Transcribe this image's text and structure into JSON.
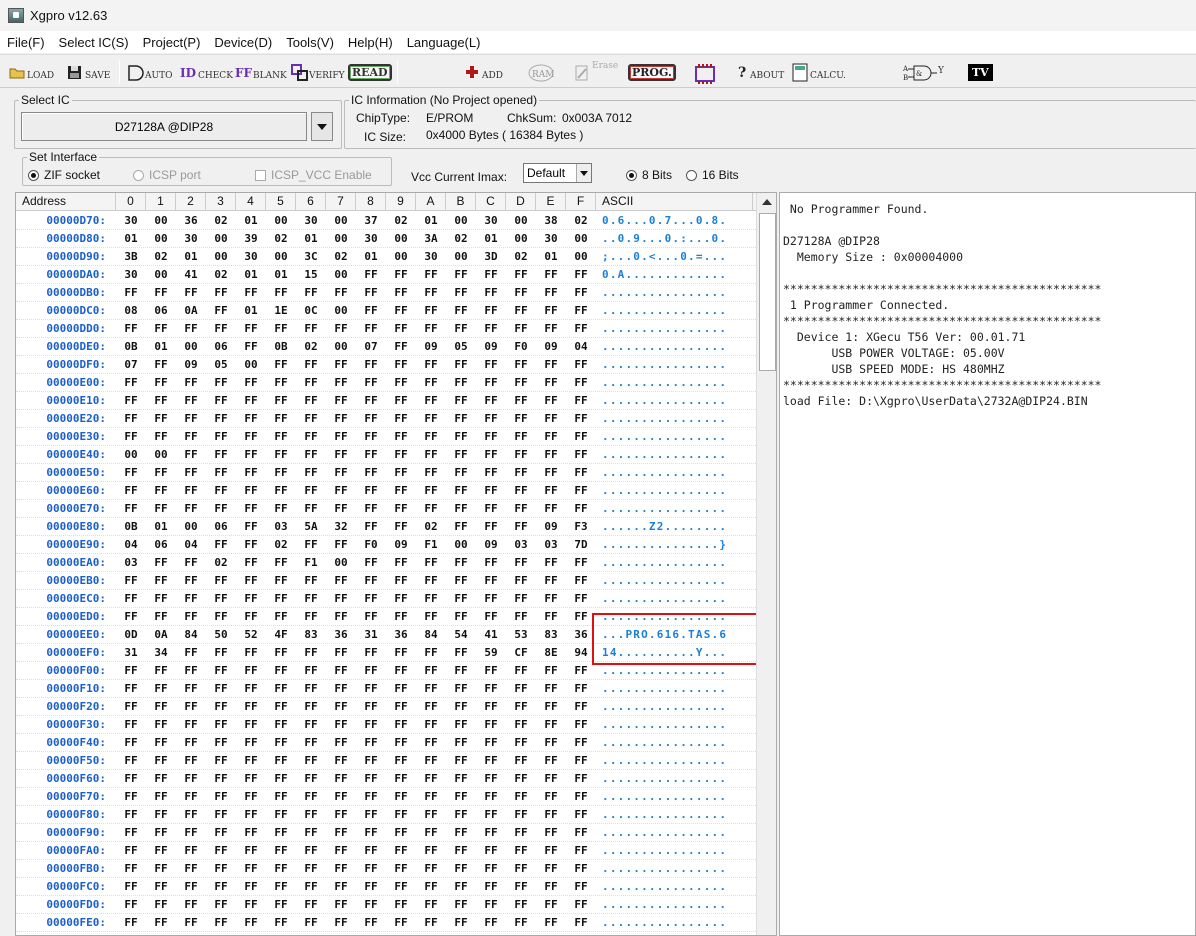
{
  "window": {
    "title": "Xgpro v12.63"
  },
  "menu": [
    "File(F)",
    "Select IC(S)",
    "Project(P)",
    "Device(D)",
    "Tools(V)",
    "Help(H)",
    "Language(L)"
  ],
  "toolbar": {
    "load": "LOAD",
    "save": "SAVE",
    "auto": "AUTO",
    "check": "CHECK",
    "blank": "BLANK",
    "verify": "VERIFY",
    "read": "READ",
    "add": "ADD",
    "ram": "RAM",
    "erase": "Erase",
    "prog": "PROG.",
    "about": "ABOUT",
    "calcu": "CALCU.",
    "logic_y": "Y",
    "tv": "TV"
  },
  "select_ic": {
    "legend": "Select IC",
    "value": "D27128A @DIP28"
  },
  "ic_info": {
    "legend": "IC Information (No Project opened)",
    "chiptype_label": "ChipType:",
    "chiptype": "E/PROM",
    "chksum_label": "ChkSum:",
    "chksum": "0x003A 7012",
    "icsize_label": "IC Size:",
    "icsize": "0x4000 Bytes ( 16384 Bytes )"
  },
  "interface": {
    "legend": "Set Interface",
    "zif": "ZIF socket",
    "icsp": "ICSP port",
    "icsp_vcc": "ICSP_VCC Enable"
  },
  "vcc": {
    "label": "Vcc Current Imax:",
    "value": "Default"
  },
  "bits": {
    "opt8": "8 Bits",
    "opt16": "16 Bits",
    "selected": "8 Bits"
  },
  "hex": {
    "headers": [
      "Address",
      "0",
      "1",
      "2",
      "3",
      "4",
      "5",
      "6",
      "7",
      "8",
      "9",
      "A",
      "B",
      "C",
      "D",
      "E",
      "F",
      "ASCII"
    ],
    "rows": [
      {
        "addr": "00000D70:",
        "bytes": [
          "30",
          "00",
          "36",
          "02",
          "01",
          "00",
          "30",
          "00",
          "37",
          "02",
          "01",
          "00",
          "30",
          "00",
          "38",
          "02"
        ],
        "ascii": "0.6...0.7...0.8."
      },
      {
        "addr": "00000D80:",
        "bytes": [
          "01",
          "00",
          "30",
          "00",
          "39",
          "02",
          "01",
          "00",
          "30",
          "00",
          "3A",
          "02",
          "01",
          "00",
          "30",
          "00"
        ],
        "ascii": "..0.9...0.:...0."
      },
      {
        "addr": "00000D90:",
        "bytes": [
          "3B",
          "02",
          "01",
          "00",
          "30",
          "00",
          "3C",
          "02",
          "01",
          "00",
          "30",
          "00",
          "3D",
          "02",
          "01",
          "00"
        ],
        "ascii": ";...0.<...0.=..."
      },
      {
        "addr": "00000DA0:",
        "bytes": [
          "30",
          "00",
          "41",
          "02",
          "01",
          "01",
          "15",
          "00",
          "FF",
          "FF",
          "FF",
          "FF",
          "FF",
          "FF",
          "FF",
          "FF"
        ],
        "ascii": "0.A............."
      },
      {
        "addr": "00000DB0:",
        "bytes": [
          "FF",
          "FF",
          "FF",
          "FF",
          "FF",
          "FF",
          "FF",
          "FF",
          "FF",
          "FF",
          "FF",
          "FF",
          "FF",
          "FF",
          "FF",
          "FF"
        ],
        "ascii": "................"
      },
      {
        "addr": "00000DC0:",
        "bytes": [
          "08",
          "06",
          "0A",
          "FF",
          "01",
          "1E",
          "0C",
          "00",
          "FF",
          "FF",
          "FF",
          "FF",
          "FF",
          "FF",
          "FF",
          "FF"
        ],
        "ascii": "................"
      },
      {
        "addr": "00000DD0:",
        "bytes": [
          "FF",
          "FF",
          "FF",
          "FF",
          "FF",
          "FF",
          "FF",
          "FF",
          "FF",
          "FF",
          "FF",
          "FF",
          "FF",
          "FF",
          "FF",
          "FF"
        ],
        "ascii": "................"
      },
      {
        "addr": "00000DE0:",
        "bytes": [
          "0B",
          "01",
          "00",
          "06",
          "FF",
          "0B",
          "02",
          "00",
          "07",
          "FF",
          "09",
          "05",
          "09",
          "F0",
          "09",
          "04"
        ],
        "ascii": "................"
      },
      {
        "addr": "00000DF0:",
        "bytes": [
          "07",
          "FF",
          "09",
          "05",
          "00",
          "FF",
          "FF",
          "FF",
          "FF",
          "FF",
          "FF",
          "FF",
          "FF",
          "FF",
          "FF",
          "FF"
        ],
        "ascii": "................"
      },
      {
        "addr": "00000E00:",
        "bytes": [
          "FF",
          "FF",
          "FF",
          "FF",
          "FF",
          "FF",
          "FF",
          "FF",
          "FF",
          "FF",
          "FF",
          "FF",
          "FF",
          "FF",
          "FF",
          "FF"
        ],
        "ascii": "................"
      },
      {
        "addr": "00000E10:",
        "bytes": [
          "FF",
          "FF",
          "FF",
          "FF",
          "FF",
          "FF",
          "FF",
          "FF",
          "FF",
          "FF",
          "FF",
          "FF",
          "FF",
          "FF",
          "FF",
          "FF"
        ],
        "ascii": "................"
      },
      {
        "addr": "00000E20:",
        "bytes": [
          "FF",
          "FF",
          "FF",
          "FF",
          "FF",
          "FF",
          "FF",
          "FF",
          "FF",
          "FF",
          "FF",
          "FF",
          "FF",
          "FF",
          "FF",
          "FF"
        ],
        "ascii": "................"
      },
      {
        "addr": "00000E30:",
        "bytes": [
          "FF",
          "FF",
          "FF",
          "FF",
          "FF",
          "FF",
          "FF",
          "FF",
          "FF",
          "FF",
          "FF",
          "FF",
          "FF",
          "FF",
          "FF",
          "FF"
        ],
        "ascii": "................"
      },
      {
        "addr": "00000E40:",
        "bytes": [
          "00",
          "00",
          "FF",
          "FF",
          "FF",
          "FF",
          "FF",
          "FF",
          "FF",
          "FF",
          "FF",
          "FF",
          "FF",
          "FF",
          "FF",
          "FF"
        ],
        "ascii": "................"
      },
      {
        "addr": "00000E50:",
        "bytes": [
          "FF",
          "FF",
          "FF",
          "FF",
          "FF",
          "FF",
          "FF",
          "FF",
          "FF",
          "FF",
          "FF",
          "FF",
          "FF",
          "FF",
          "FF",
          "FF"
        ],
        "ascii": "................"
      },
      {
        "addr": "00000E60:",
        "bytes": [
          "FF",
          "FF",
          "FF",
          "FF",
          "FF",
          "FF",
          "FF",
          "FF",
          "FF",
          "FF",
          "FF",
          "FF",
          "FF",
          "FF",
          "FF",
          "FF"
        ],
        "ascii": "................"
      },
      {
        "addr": "00000E70:",
        "bytes": [
          "FF",
          "FF",
          "FF",
          "FF",
          "FF",
          "FF",
          "FF",
          "FF",
          "FF",
          "FF",
          "FF",
          "FF",
          "FF",
          "FF",
          "FF",
          "FF"
        ],
        "ascii": "................"
      },
      {
        "addr": "00000E80:",
        "bytes": [
          "0B",
          "01",
          "00",
          "06",
          "FF",
          "03",
          "5A",
          "32",
          "FF",
          "FF",
          "02",
          "FF",
          "FF",
          "FF",
          "09",
          "F3"
        ],
        "ascii": "......Z2........"
      },
      {
        "addr": "00000E90:",
        "bytes": [
          "04",
          "06",
          "04",
          "FF",
          "FF",
          "02",
          "FF",
          "FF",
          "F0",
          "09",
          "F1",
          "00",
          "09",
          "03",
          "03",
          "7D"
        ],
        "ascii": "...............}"
      },
      {
        "addr": "00000EA0:",
        "bytes": [
          "03",
          "FF",
          "FF",
          "02",
          "FF",
          "FF",
          "F1",
          "00",
          "FF",
          "FF",
          "FF",
          "FF",
          "FF",
          "FF",
          "FF",
          "FF"
        ],
        "ascii": "................"
      },
      {
        "addr": "00000EB0:",
        "bytes": [
          "FF",
          "FF",
          "FF",
          "FF",
          "FF",
          "FF",
          "FF",
          "FF",
          "FF",
          "FF",
          "FF",
          "FF",
          "FF",
          "FF",
          "FF",
          "FF"
        ],
        "ascii": "................"
      },
      {
        "addr": "00000EC0:",
        "bytes": [
          "FF",
          "FF",
          "FF",
          "FF",
          "FF",
          "FF",
          "FF",
          "FF",
          "FF",
          "FF",
          "FF",
          "FF",
          "FF",
          "FF",
          "FF",
          "FF"
        ],
        "ascii": "................"
      },
      {
        "addr": "00000ED0:",
        "bytes": [
          "FF",
          "FF",
          "FF",
          "FF",
          "FF",
          "FF",
          "FF",
          "FF",
          "FF",
          "FF",
          "FF",
          "FF",
          "FF",
          "FF",
          "FF",
          "FF"
        ],
        "ascii": "................"
      },
      {
        "addr": "00000EE0:",
        "bytes": [
          "0D",
          "0A",
          "84",
          "50",
          "52",
          "4F",
          "83",
          "36",
          "31",
          "36",
          "84",
          "54",
          "41",
          "53",
          "83",
          "36"
        ],
        "ascii": "...PRO.616.TAS.6"
      },
      {
        "addr": "00000EF0:",
        "bytes": [
          "31",
          "34",
          "FF",
          "FF",
          "FF",
          "FF",
          "FF",
          "FF",
          "FF",
          "FF",
          "FF",
          "FF",
          "59",
          "CF",
          "8E",
          "94"
        ],
        "ascii": "14..........Y..."
      },
      {
        "addr": "00000F00:",
        "bytes": [
          "FF",
          "FF",
          "FF",
          "FF",
          "FF",
          "FF",
          "FF",
          "FF",
          "FF",
          "FF",
          "FF",
          "FF",
          "FF",
          "FF",
          "FF",
          "FF"
        ],
        "ascii": "................"
      },
      {
        "addr": "00000F10:",
        "bytes": [
          "FF",
          "FF",
          "FF",
          "FF",
          "FF",
          "FF",
          "FF",
          "FF",
          "FF",
          "FF",
          "FF",
          "FF",
          "FF",
          "FF",
          "FF",
          "FF"
        ],
        "ascii": "................"
      },
      {
        "addr": "00000F20:",
        "bytes": [
          "FF",
          "FF",
          "FF",
          "FF",
          "FF",
          "FF",
          "FF",
          "FF",
          "FF",
          "FF",
          "FF",
          "FF",
          "FF",
          "FF",
          "FF",
          "FF"
        ],
        "ascii": "................"
      },
      {
        "addr": "00000F30:",
        "bytes": [
          "FF",
          "FF",
          "FF",
          "FF",
          "FF",
          "FF",
          "FF",
          "FF",
          "FF",
          "FF",
          "FF",
          "FF",
          "FF",
          "FF",
          "FF",
          "FF"
        ],
        "ascii": "................"
      },
      {
        "addr": "00000F40:",
        "bytes": [
          "FF",
          "FF",
          "FF",
          "FF",
          "FF",
          "FF",
          "FF",
          "FF",
          "FF",
          "FF",
          "FF",
          "FF",
          "FF",
          "FF",
          "FF",
          "FF"
        ],
        "ascii": "................"
      },
      {
        "addr": "00000F50:",
        "bytes": [
          "FF",
          "FF",
          "FF",
          "FF",
          "FF",
          "FF",
          "FF",
          "FF",
          "FF",
          "FF",
          "FF",
          "FF",
          "FF",
          "FF",
          "FF",
          "FF"
        ],
        "ascii": "................"
      },
      {
        "addr": "00000F60:",
        "bytes": [
          "FF",
          "FF",
          "FF",
          "FF",
          "FF",
          "FF",
          "FF",
          "FF",
          "FF",
          "FF",
          "FF",
          "FF",
          "FF",
          "FF",
          "FF",
          "FF"
        ],
        "ascii": "................"
      },
      {
        "addr": "00000F70:",
        "bytes": [
          "FF",
          "FF",
          "FF",
          "FF",
          "FF",
          "FF",
          "FF",
          "FF",
          "FF",
          "FF",
          "FF",
          "FF",
          "FF",
          "FF",
          "FF",
          "FF"
        ],
        "ascii": "................"
      },
      {
        "addr": "00000F80:",
        "bytes": [
          "FF",
          "FF",
          "FF",
          "FF",
          "FF",
          "FF",
          "FF",
          "FF",
          "FF",
          "FF",
          "FF",
          "FF",
          "FF",
          "FF",
          "FF",
          "FF"
        ],
        "ascii": "................"
      },
      {
        "addr": "00000F90:",
        "bytes": [
          "FF",
          "FF",
          "FF",
          "FF",
          "FF",
          "FF",
          "FF",
          "FF",
          "FF",
          "FF",
          "FF",
          "FF",
          "FF",
          "FF",
          "FF",
          "FF"
        ],
        "ascii": "................"
      },
      {
        "addr": "00000FA0:",
        "bytes": [
          "FF",
          "FF",
          "FF",
          "FF",
          "FF",
          "FF",
          "FF",
          "FF",
          "FF",
          "FF",
          "FF",
          "FF",
          "FF",
          "FF",
          "FF",
          "FF"
        ],
        "ascii": "................"
      },
      {
        "addr": "00000FB0:",
        "bytes": [
          "FF",
          "FF",
          "FF",
          "FF",
          "FF",
          "FF",
          "FF",
          "FF",
          "FF",
          "FF",
          "FF",
          "FF",
          "FF",
          "FF",
          "FF",
          "FF"
        ],
        "ascii": "................"
      },
      {
        "addr": "00000FC0:",
        "bytes": [
          "FF",
          "FF",
          "FF",
          "FF",
          "FF",
          "FF",
          "FF",
          "FF",
          "FF",
          "FF",
          "FF",
          "FF",
          "FF",
          "FF",
          "FF",
          "FF"
        ],
        "ascii": "................"
      },
      {
        "addr": "00000FD0:",
        "bytes": [
          "FF",
          "FF",
          "FF",
          "FF",
          "FF",
          "FF",
          "FF",
          "FF",
          "FF",
          "FF",
          "FF",
          "FF",
          "FF",
          "FF",
          "FF",
          "FF"
        ],
        "ascii": "................"
      },
      {
        "addr": "00000FE0:",
        "bytes": [
          "FF",
          "FF",
          "FF",
          "FF",
          "FF",
          "FF",
          "FF",
          "FF",
          "FF",
          "FF",
          "FF",
          "FF",
          "FF",
          "FF",
          "FF",
          "FF"
        ],
        "ascii": "................"
      }
    ]
  },
  "log": [
    " No Programmer Found.",
    "",
    "D27128A @DIP28",
    "  Memory Size : 0x00004000",
    "",
    "**********************************************",
    " 1 Programmer Connected.",
    "**********************************************",
    "  Device 1: XGecu T56 Ver: 00.01.71",
    "       USB POWER VOLTAGE: 05.00V",
    "       USB SPEED MODE: HS 480MHZ",
    "**********************************************",
    "load File: D:\\Xgpro\\UserData\\2732A@DIP24.BIN"
  ],
  "colors": {
    "address": "#1a5fd0",
    "ascii": "#1a7fd8",
    "highlight": "#e01010"
  }
}
